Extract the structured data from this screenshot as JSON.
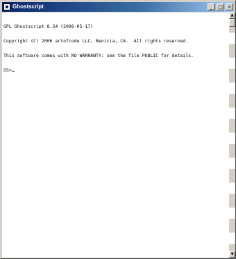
{
  "window": {
    "title": "Ghostscript",
    "buttons": {
      "minimize": "_",
      "maximize": "□",
      "close": "×"
    }
  },
  "console": {
    "lines": [
      "GPL Ghostscript 8.54 (2006-05-17)",
      "Copyright (C) 2006 artofcode LLC, Benicia, CA.  All rights reserved.",
      "This software comes with NO WARRANTY: see the file PUBLIC for details.",
      "GS>"
    ]
  },
  "scrollbar": {
    "up_arrow": "▲",
    "down_arrow": "▼"
  },
  "colors": {
    "titlebar_start": "#0a246a",
    "titlebar_end": "#a6caf0",
    "console_bg": "#ffffff",
    "console_text": "#000000"
  }
}
